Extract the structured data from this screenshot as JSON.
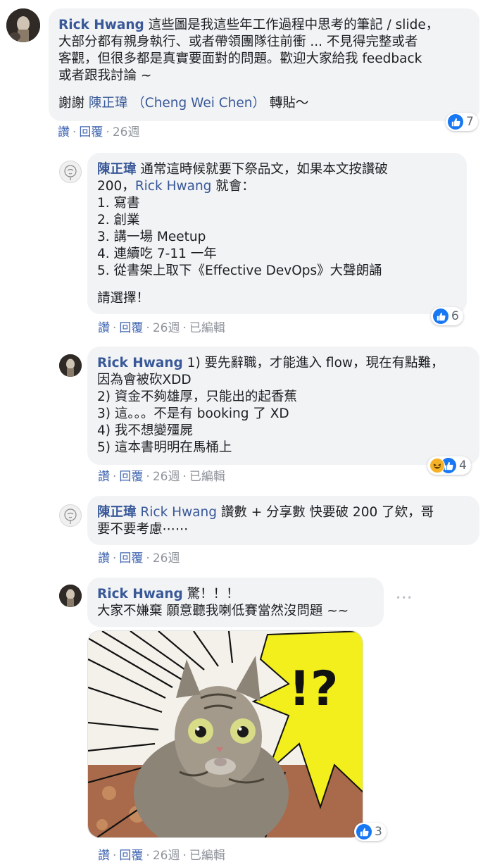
{
  "comments": [
    {
      "author": "Rick Hwang",
      "lines": [
        "這些圖是我這些年工作過程中思考的筆記 / slide，",
        "大部分都有親身執行、或者帶領團隊往前衝 ... 不見得完整或者",
        "客觀，但很多都是真實要面對的問題。歡迎大家給我 feedback",
        "或者跟我討論 ~"
      ],
      "thanks_prefix": "謝謝 ",
      "thanks_mention": "陳正瑋 （Cheng Wei Chen）",
      "thanks_suffix": " 轉貼～",
      "reaction_count": "7",
      "actions": {
        "like": "讚",
        "reply": "回覆",
        "time": "26週"
      }
    },
    {
      "author": "陳正瑋",
      "lines": [
        "通常這時候就要下祭品文，如果本文按讚破",
        "200，",
        "1. 寫書",
        "2. 創業",
        "3. 講一場 Meetup",
        "4. 連續吃 7-11 一年",
        "5. 從書架上取下《Effective DevOps》大聲朗誦",
        "請選擇！"
      ],
      "mention": "Rick Hwang",
      "mention_suffix": " 就會：",
      "reaction_count": "6",
      "actions": {
        "like": "讚",
        "reply": "回覆",
        "time": "26週",
        "edited": "已編輯"
      }
    },
    {
      "author": "Rick Hwang",
      "lines": [
        "1) 要先辭職，才能進入 flow，現在有點難，",
        "因為會被砍XDD",
        "2) 資金不夠雄厚，只能出的起香蕉",
        "3) 這。。。不是有 booking 了 XD",
        "4) 我不想變殭屍",
        "5) 這本書明明在馬桶上"
      ],
      "reaction_count": "4",
      "actions": {
        "like": "讚",
        "reply": "回覆",
        "time": "26週",
        "edited": "已編輯"
      }
    },
    {
      "author": "陳正瑋",
      "mention": "Rick Hwang",
      "lines": [
        " 讚數 + 分享數 快要破 200 了欸，哥",
        "要不要考慮⋯⋯"
      ],
      "actions": {
        "like": "讚",
        "reply": "回覆",
        "time": "26週"
      }
    },
    {
      "author": "Rick Hwang",
      "lines": [
        " 驚！！！",
        "大家不嫌棄 願意聽我喇低賽當然沒問題 ~~"
      ],
      "more_label": "•••",
      "image_text": "!?",
      "reaction_count": "3",
      "actions": {
        "like": "讚",
        "reply": "回覆",
        "time": "26週",
        "edited": "已編輯"
      }
    }
  ],
  "icons": {
    "like": "like-icon",
    "haha": "haha-icon",
    "avatar_rick": "avatar-rick",
    "avatar_chen": "avatar-chen"
  },
  "colors": {
    "link": "#385898",
    "action": "#4267b2",
    "bubble": "#f2f3f5",
    "meta": "#90949c",
    "like_blue": "#1877f2"
  }
}
